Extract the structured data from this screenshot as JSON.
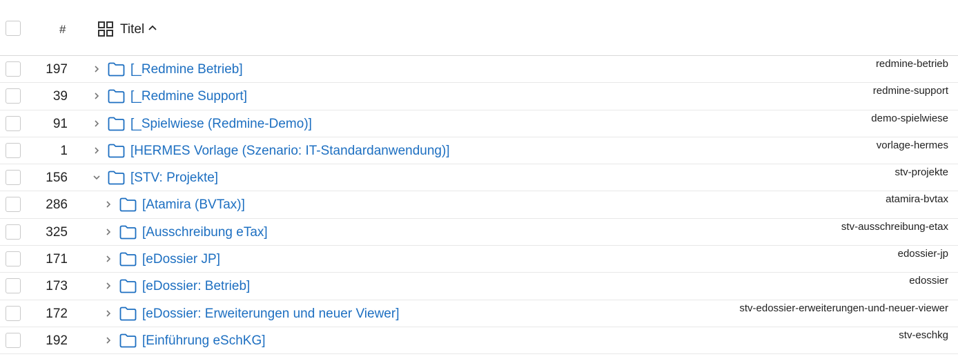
{
  "header": {
    "number_label": "#",
    "title_label": "Titel"
  },
  "rows": [
    {
      "number": "197",
      "title": "[_Redmine Betrieb]",
      "identifier": "redmine-betrieb",
      "expanded": false,
      "level": 0
    },
    {
      "number": "39",
      "title": "[_Redmine Support]",
      "identifier": "redmine-support",
      "expanded": false,
      "level": 0
    },
    {
      "number": "91",
      "title": "[_Spielwiese (Redmine-Demo)]",
      "identifier": "demo-spielwiese",
      "expanded": false,
      "level": 0
    },
    {
      "number": "1",
      "title": "[HERMES Vorlage (Szenario: IT-Standardanwendung)]",
      "identifier": "vorlage-hermes",
      "expanded": false,
      "level": 0
    },
    {
      "number": "156",
      "title": "[STV: Projekte]",
      "identifier": "stv-projekte",
      "expanded": true,
      "level": 0
    },
    {
      "number": "286",
      "title": "[Atamira (BVTax)]",
      "identifier": "atamira-bvtax",
      "expanded": false,
      "level": 1
    },
    {
      "number": "325",
      "title": "[Ausschreibung eTax]",
      "identifier": "stv-ausschreibung-etax",
      "expanded": false,
      "level": 1
    },
    {
      "number": "171",
      "title": "[eDossier JP]",
      "identifier": "edossier-jp",
      "expanded": false,
      "level": 1
    },
    {
      "number": "173",
      "title": "[eDossier: Betrieb]",
      "identifier": "edossier",
      "expanded": false,
      "level": 1
    },
    {
      "number": "172",
      "title": "[eDossier: Erweiterungen und neuer Viewer]",
      "identifier": "stv-edossier-erweiterungen-und-neuer-viewer",
      "expanded": false,
      "level": 1
    },
    {
      "number": "192",
      "title": "[Einführung eSchKG]",
      "identifier": "stv-eschkg",
      "expanded": false,
      "level": 1
    }
  ],
  "colors": {
    "link": "#1d6fc1",
    "checkbox_border": "#c9c9c9",
    "icon": "#666666"
  }
}
